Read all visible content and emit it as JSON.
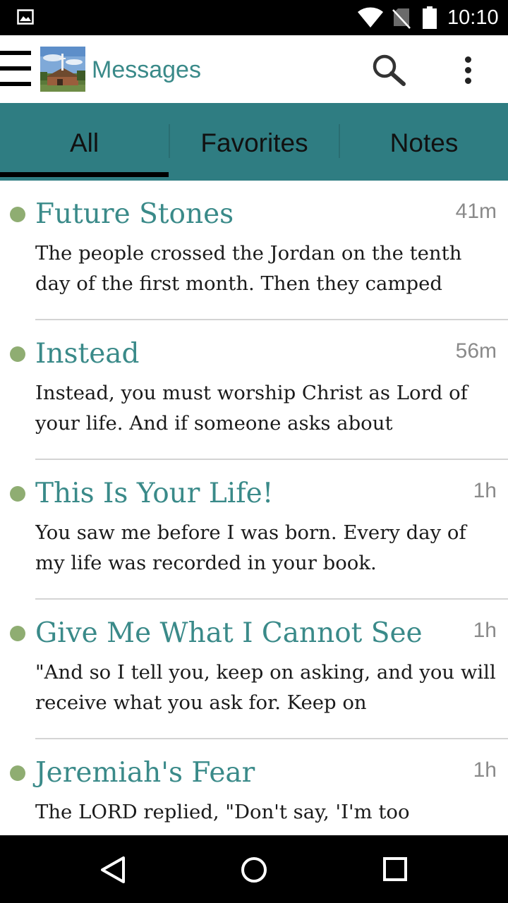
{
  "status_bar": {
    "time": "10:10",
    "icons": [
      "gallery-icon",
      "wifi-icon",
      "no-sim-icon",
      "battery-icon"
    ]
  },
  "app_bar": {
    "title": "Messages",
    "logo": "church-logo",
    "actions": [
      "search-icon",
      "overflow-menu-icon"
    ]
  },
  "tabs": [
    {
      "label": "All",
      "selected": true
    },
    {
      "label": "Favorites",
      "selected": false
    },
    {
      "label": "Notes",
      "selected": false
    }
  ],
  "messages": [
    {
      "title": "Future Stones",
      "time": "41m",
      "preview": "The people crossed the Jordan on the tenth day of the first month. Then they camped",
      "unread": true
    },
    {
      "title": "Instead",
      "time": "56m",
      "preview": "Instead, you must worship Christ as Lord of your life. And if someone asks about",
      "unread": true
    },
    {
      "title": "This Is Your Life!",
      "time": "1h",
      "preview": "You saw me before I was born. Every day of my life was recorded in your book.",
      "unread": true
    },
    {
      "title": "Give Me What I Cannot See",
      "time": "1h",
      "preview": "\"And so I tell you, keep on asking, and you will receive what you ask for. Keep on",
      "unread": true
    },
    {
      "title": "Jeremiah's Fear",
      "time": "1h",
      "preview": "The LORD replied, \"Don't say, 'I'm too",
      "unread": true
    }
  ],
  "colors": {
    "accent": "#3a8a89",
    "tab_bar": "#2f7d82",
    "unread_dot": "#8fad72",
    "status_bar": "#000000"
  },
  "nav_bar": {
    "icons": [
      "back-icon",
      "home-icon",
      "recents-icon"
    ]
  }
}
